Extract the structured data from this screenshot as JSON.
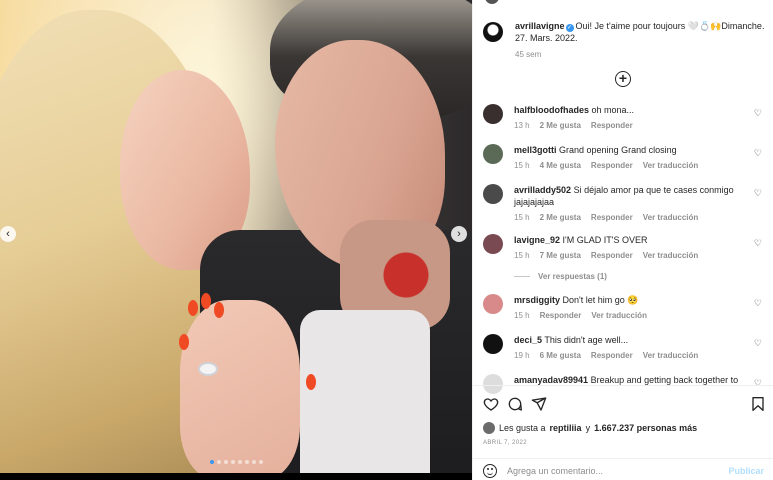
{
  "post": {
    "nav": {
      "prev_icon": "chevron-left-icon",
      "next_icon": "chevron-right-icon",
      "prev_glyph": "‹",
      "next_glyph": "›"
    },
    "carousel": {
      "total": 8,
      "active": 0
    }
  },
  "caption": {
    "username": "avrillavigne",
    "text": "Oui! Je t'aime pour toujours 🤍💍🙌Dimanche. 27. Mars. 2022.",
    "time": "45 sem"
  },
  "comments": [
    {
      "username": "halfbloodofhades",
      "text": "oh mona...",
      "time": "13 h",
      "likes": "2 Me gusta",
      "reply": "Responder",
      "translate": "",
      "avatar_color": "#3a2f2f"
    },
    {
      "username": "mell3gotti",
      "text": "Grand opening Grand closing",
      "time": "15 h",
      "likes": "4 Me gusta",
      "reply": "Responder",
      "translate": "Ver traducción",
      "avatar_color": "#5b6a57"
    },
    {
      "username": "avrilladdy502",
      "text": "Si déjalo amor pa que te cases conmigo jajajajajaa",
      "time": "15 h",
      "likes": "2 Me gusta",
      "reply": "Responder",
      "translate": "Ver traducción",
      "avatar_color": "#4a4a4a"
    },
    {
      "username": "lavigne_92",
      "text": "I'M GLAD IT'S OVER",
      "time": "15 h",
      "likes": "7 Me gusta",
      "reply": "Responder",
      "translate": "Ver traducción",
      "avatar_color": "#7a4a52"
    },
    {
      "username": "mrsdiggity",
      "text": "Don't let him go 🥺",
      "time": "15 h",
      "likes": "",
      "reply": "Responder",
      "translate": "Ver traducción",
      "avatar_color": "#d88a8a"
    },
    {
      "username": "deci_5",
      "text": "This didn't age well...",
      "time": "19 h",
      "likes": "6 Me gusta",
      "reply": "Responder",
      "translate": "Ver traducción",
      "avatar_color": "#111111"
    },
    {
      "username": "amanyadav89941",
      "text": "Breakup and getting back together to",
      "time": "",
      "likes": "",
      "reply": "",
      "translate": "",
      "avatar_color": "#dddddd"
    }
  ],
  "replies_label": "Ver respuestas (1)",
  "actions": {
    "like_icon": "heart-icon",
    "comment_icon": "comment-icon",
    "share_icon": "share-icon",
    "save_icon": "bookmark-icon"
  },
  "likes": {
    "prefix": "Les gusta a",
    "user": "reptiliia",
    "connector": "y",
    "count": "1.667.237 personas más"
  },
  "date": "ABRIL 7, 2022",
  "add_comment": {
    "placeholder": "Agrega un comentario...",
    "publish_label": "Publicar"
  },
  "colors": {
    "accent": "#3897f0",
    "publish_disabled": "#b2dffc",
    "muted": "#8e8e8e",
    "nail": "#ef4a24"
  }
}
